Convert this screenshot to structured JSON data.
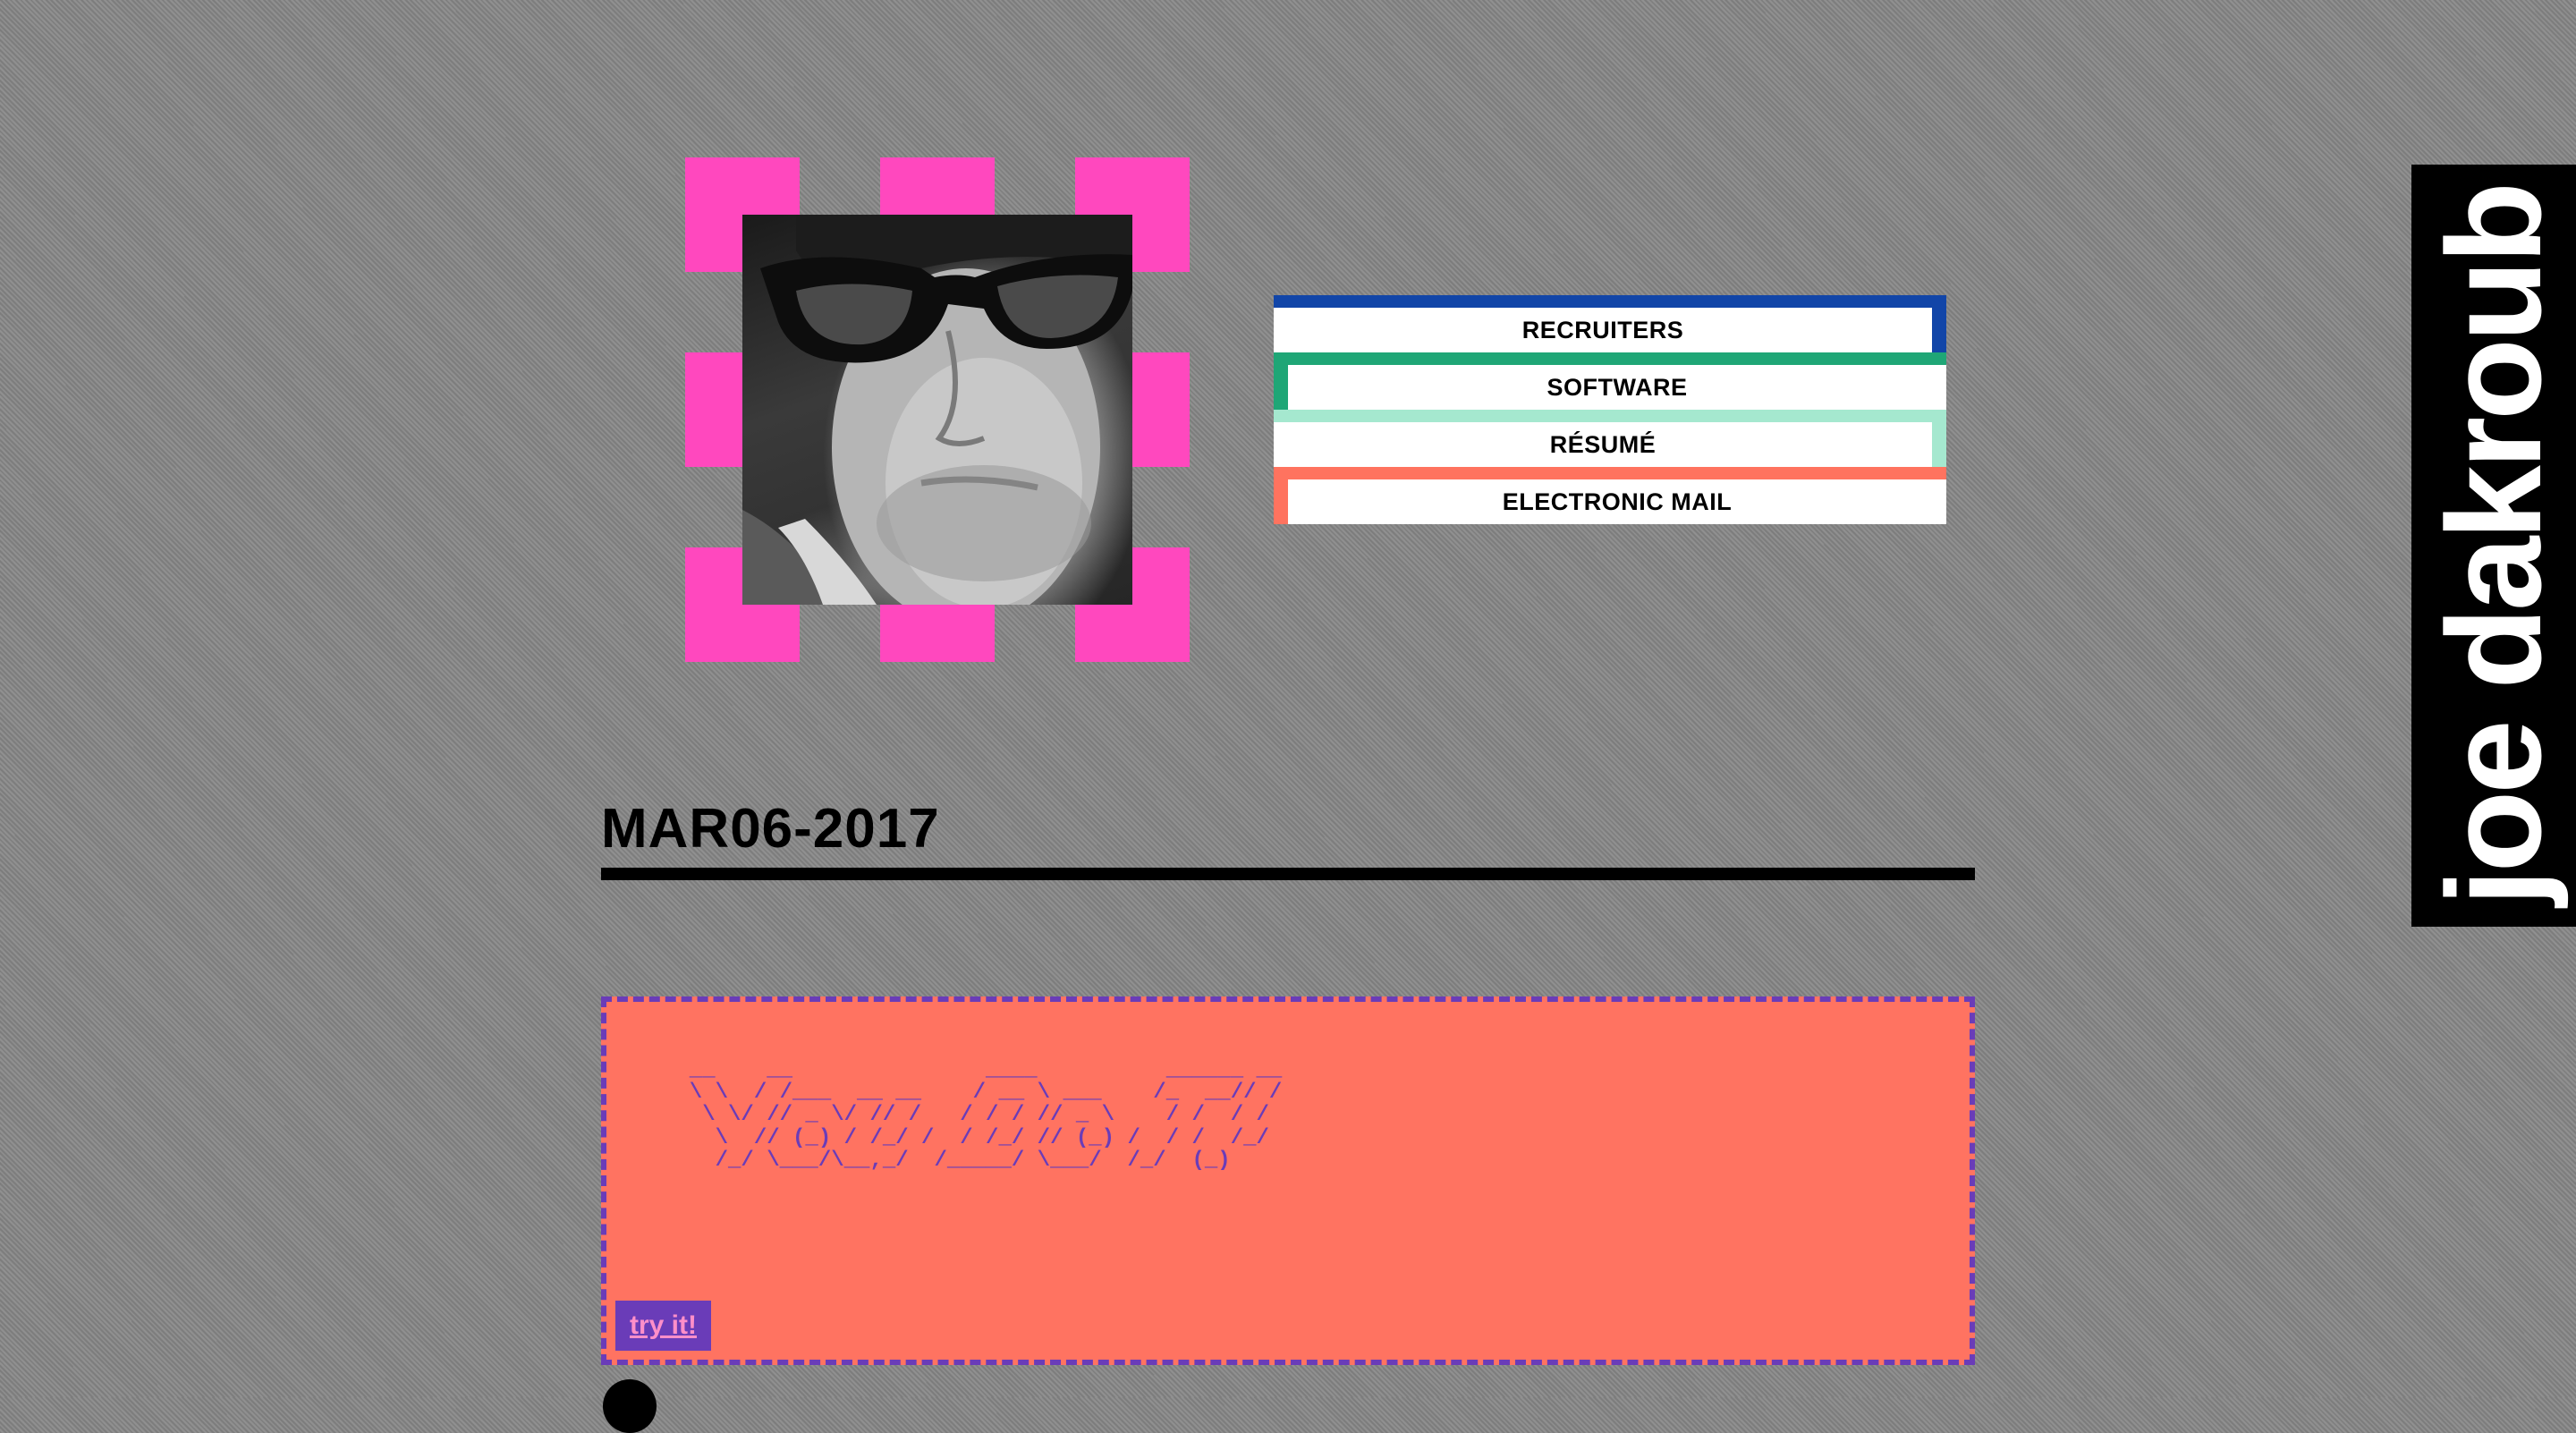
{
  "profile": {
    "portrait_alt": "portrait photo"
  },
  "nav": {
    "items": [
      {
        "label": "RECRUITERS",
        "color": "#1145a8"
      },
      {
        "label": "SOFTWARE",
        "color": "#1fa676"
      },
      {
        "label": "RÉSUMÉ",
        "color": "#a5e8cf"
      },
      {
        "label": "ELECTRONIC MAIL",
        "color": "#ff735f"
      }
    ]
  },
  "site": {
    "name": "joe dakroub"
  },
  "post": {
    "date": "MAR06-2017"
  },
  "demo": {
    "ascii_art": "  __    __               ____          ______ __\n  \\ \\  / /___  __ __    / __ \\ ___    /_  __// /\n   \\ \\/ // _ \\/ // /   / / / // _ \\    / /  / / \n    \\  // (_) / /_/ /  / /_/ // (_) /  / /  /_/  \n    /_/ \\___/\\__,_/  /_____/ \\___/  /_/  (_)    ",
    "button_label": "try it!"
  },
  "colors": {
    "accent_pink": "#ff48be",
    "card_bg": "#ff7361",
    "card_border": "#6a3cb8",
    "background": "#8a8a8a"
  }
}
